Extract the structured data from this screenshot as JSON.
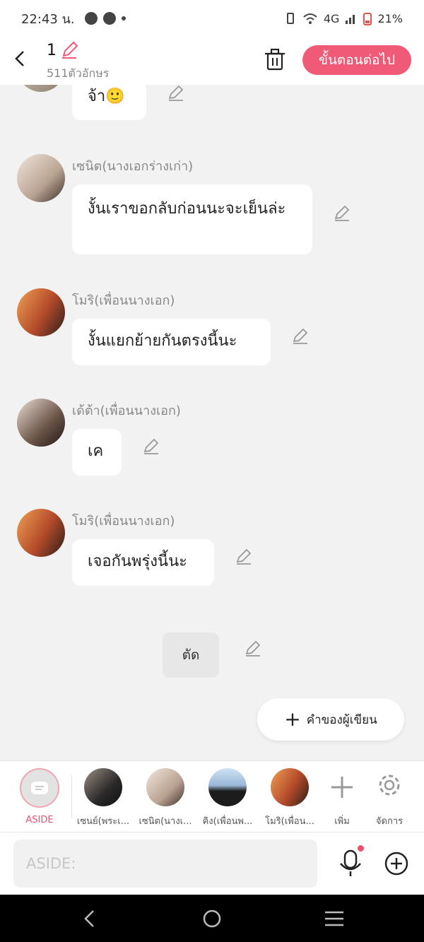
{
  "status_bar": {
    "time": "22:43 น.",
    "network": "4G",
    "battery": "21%"
  },
  "header": {
    "title": "1",
    "char_count": "511ตัวอักษร",
    "next_label": "ขั้นตอนต่อไป"
  },
  "messages": [
    {
      "speaker": "",
      "text": "จ้า🙂"
    },
    {
      "speaker": "เซนิต(นางเอกร่างเก่า)",
      "text": "งั้นเราขอกลับก่อนนะจะเย็นล่ะ"
    },
    {
      "speaker": "โมริ(เพื่อนนางเอก)",
      "text": "งั้นแยกย้ายกันตรงนี้นะ"
    },
    {
      "speaker": "เด้ต้า(เพื่อนนางเอก)",
      "text": "เค"
    },
    {
      "speaker": "โมริ(เพื่อนนางเอก)",
      "text": "เจอกันพรุ่งนี้นะ"
    }
  ],
  "cut_label": "ตัด",
  "author_button_label": "คำของผู้เขียน",
  "characters": [
    {
      "label": "ASIDE"
    },
    {
      "label": "เซนย์(พระเ..."
    },
    {
      "label": "เซนิต(นางเ..."
    },
    {
      "label": "คิง(เพื่อนพ..."
    },
    {
      "label": "โมริ(เพื่อน..."
    }
  ],
  "add_label": "เพิ่ม",
  "manage_label": "จัดการ",
  "input": {
    "placeholder": "ASIDE:"
  },
  "colors": {
    "accent": "#f05a77",
    "background": "#f2f2f2"
  }
}
